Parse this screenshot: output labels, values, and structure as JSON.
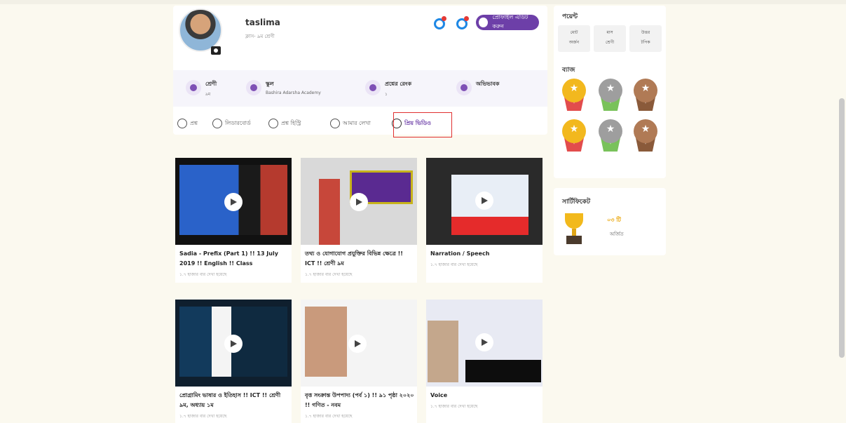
{
  "profile": {
    "name": "taslima",
    "subtitle": "ক্লাস- ৯ম শ্রেণী",
    "action_button": "প্রোফাইল এডিট করুন",
    "info": [
      {
        "title": "শ্রেণী",
        "value": "৯ম"
      },
      {
        "title": "স্কুল",
        "value": "Bashira Adarsha Academy"
      },
      {
        "title": "প্রশ্নের রেংক",
        "value": "১"
      },
      {
        "title": "অভিভাবক",
        "value": ""
      }
    ],
    "tabs": [
      {
        "label": "প্রশ্ন",
        "active": false
      },
      {
        "label": "লিডারবোর্ড",
        "active": false
      },
      {
        "label": "প্রশ্ন হিস্ট্রি",
        "active": false
      },
      {
        "label": "আমার লেখা",
        "active": false
      },
      {
        "label": "প্রিয় ভিডিও",
        "active": true
      }
    ]
  },
  "videos": [
    {
      "title": "Sadia - Prefix (Part 1) !! 13 July 2019 !! English !! Class",
      "meta": "১.৭ হাজার বার দেখা হয়েছে"
    },
    {
      "title": "তথ্য ও যোগাযোগ প্রযুক্তির বিভিন্ন ক্ষেত্রে !! ICT !! শ্রেণী ৯ম",
      "meta": "১.৭ হাজার বার দেখা হয়েছে"
    },
    {
      "title": "Narration / Speech",
      "meta": "১.৭ হাজার বার দেখা হয়েছে"
    },
    {
      "title": "প্রোগ্রামিং ভাষার ও ইতিহাস !! ICT !! শ্রেণী ৯ম, অধ্যায় ১ম",
      "meta": "১.৭ হাজার বার দেখা হয়েছে"
    },
    {
      "title": "বৃত্ত সংক্রান্ত উপপাদ্য (পর্ব ১) !! ৯১ পৃষ্ঠা ২০২০ !! গণিত - নবম",
      "meta": "১.৭ হাজার বার দেখা হয়েছে"
    },
    {
      "title": "Voice",
      "meta": "১.৭ হাজার বার দেখা হয়েছে"
    }
  ],
  "sidebar": {
    "stats_title": "পয়েন্ট",
    "stats": [
      {
        "top": "মোট",
        "bottom": "অর্জন"
      },
      {
        "top": "মাস",
        "bottom": "শ্রেণী"
      },
      {
        "top": "উত্তর",
        "bottom": "টপিক"
      }
    ],
    "badges_title": "ব্যাজ",
    "certificate_title": "সার্টিফিকেট",
    "certificate_count": "০৩ টি",
    "certificate_sub": "অর্জিত"
  }
}
